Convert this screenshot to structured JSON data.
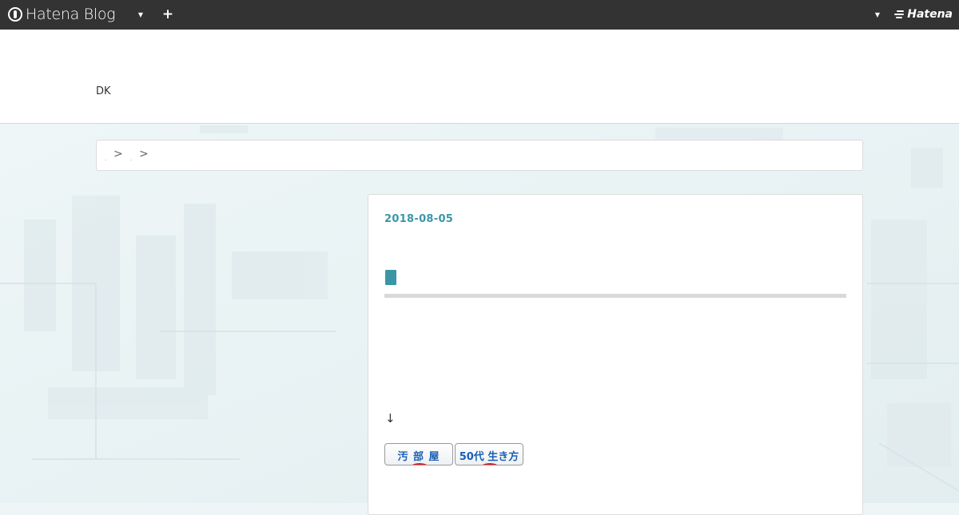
{
  "topbar": {
    "logo_text": "Hatena Blog",
    "brand_text": "Hatena"
  },
  "blog": {
    "title": "DK"
  },
  "breadcrumb": {
    "items": [
      "․",
      "․"
    ],
    "separator": ">"
  },
  "entry": {
    "date": "2018-08-05",
    "arrow": "↓",
    "banners": [
      {
        "label": "汚 部 屋"
      },
      {
        "label": "50代 生き方"
      }
    ]
  },
  "colors": {
    "topbar_bg": "#333333",
    "accent": "#3a96a7",
    "banner_text": "#1a5fb4",
    "banner_dot": "#e0141b"
  }
}
